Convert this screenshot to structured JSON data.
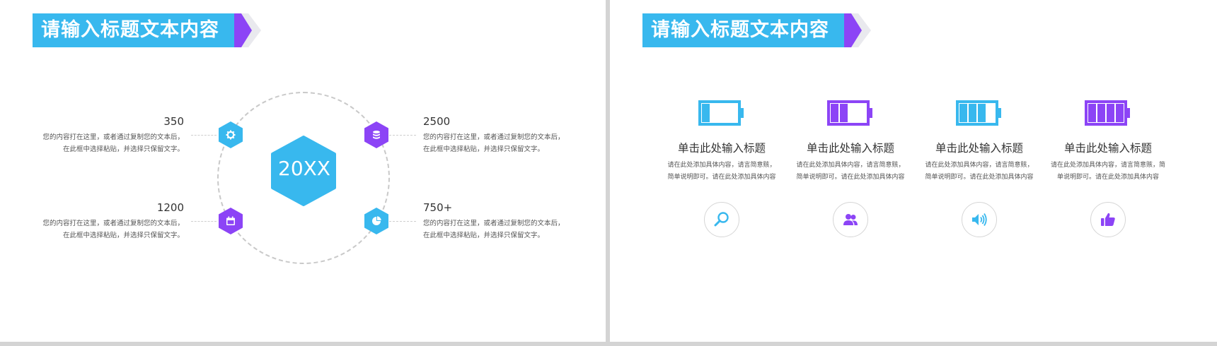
{
  "colors": {
    "blue": "#38b8ee",
    "purple": "#8c44f6",
    "banner_arrow": "#8c44f6"
  },
  "left": {
    "title": "请输入标题文本内容",
    "center_label": "20XX",
    "items": [
      {
        "value": "350",
        "desc1": "您的内容打在这里，或者通过复制您的文本后，",
        "desc2": "在此框中选择粘贴，并选择只保留文字。",
        "icon": "gear-icon"
      },
      {
        "value": "2500",
        "desc1": "您的内容打在这里，或者通过复制您的文本后，",
        "desc2": "在此框中选择粘贴，并选择只保留文字。",
        "icon": "database-icon"
      },
      {
        "value": "1200",
        "desc1": "您的内容打在这里，或者通过复制您的文本后，",
        "desc2": "在此框中选择粘贴，并选择只保留文字。",
        "icon": "calendar-icon"
      },
      {
        "value": "750+",
        "desc1": "您的内容打在这里，或者通过复制您的文本后，",
        "desc2": "在此框中选择粘贴，并选择只保留文字。",
        "icon": "pie-chart-icon"
      }
    ]
  },
  "right": {
    "title": "请输入标题文本内容",
    "columns": [
      {
        "title": "单击此处输入标题",
        "desc1": "请在此处添加具体内容，请言简意赅，",
        "desc2": "简单说明即可。请在此处添加具体内容",
        "battery_level": 0.25,
        "color": "#38b8ee",
        "icon": "search-icon"
      },
      {
        "title": "单击此处输入标题",
        "desc1": "请在此处添加具体内容，请言简意赅，",
        "desc2": "简单说明即可。请在此处添加具体内容",
        "battery_level": 0.5,
        "color": "#8c44f6",
        "icon": "users-icon"
      },
      {
        "title": "单击此处输入标题",
        "desc1": "请在此处添加具体内容，请言简意赅，",
        "desc2": "简单说明即可。请在此处添加具体内容",
        "battery_level": 0.75,
        "color": "#38b8ee",
        "icon": "speaker-icon"
      },
      {
        "title": "单击此处输入标题",
        "desc1": "请在此处添加具体内容，请言简意赅，简",
        "desc2": "单说明即可。请在此处添加具体内容",
        "battery_level": 1.0,
        "color": "#8c44f6",
        "icon": "thumbs-up-icon"
      }
    ]
  }
}
